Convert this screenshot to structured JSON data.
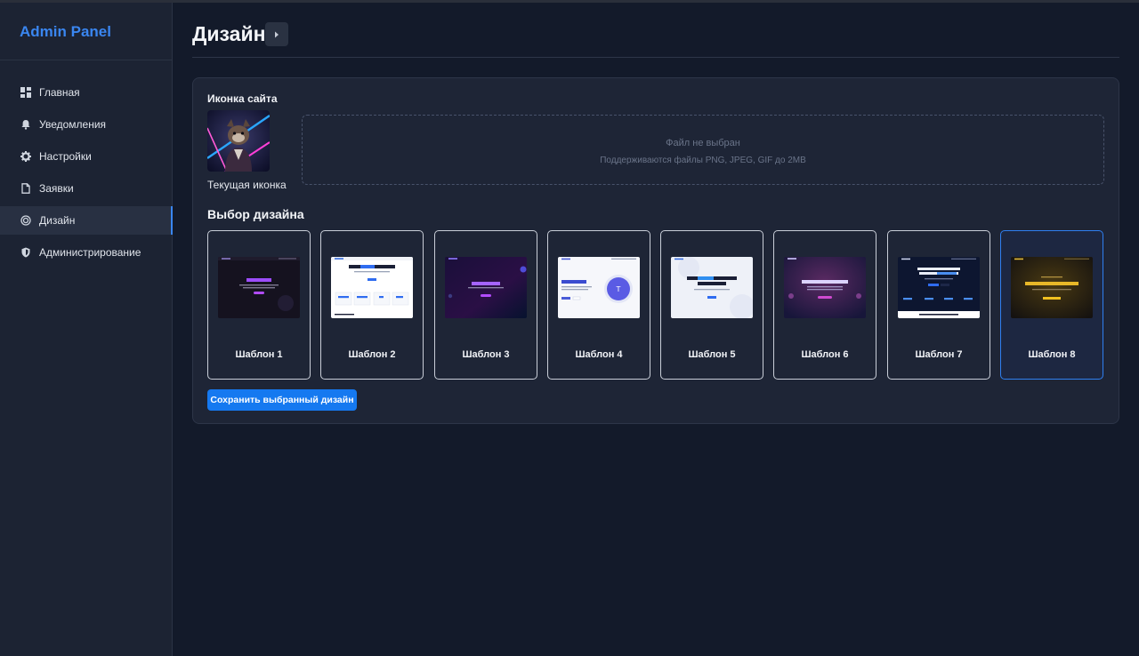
{
  "app": {
    "brand": "Admin Panel"
  },
  "sidebar": {
    "items": [
      {
        "label": "Главная",
        "icon": "dashboard-icon"
      },
      {
        "label": "Уведомления",
        "icon": "bell-icon"
      },
      {
        "label": "Настройки",
        "icon": "gear-icon"
      },
      {
        "label": "Заявки",
        "icon": "document-icon"
      },
      {
        "label": "Дизайн",
        "icon": "palette-icon",
        "active": true
      },
      {
        "label": "Администрирование",
        "icon": "shield-icon"
      }
    ]
  },
  "header": {
    "title": "Дизайн"
  },
  "favicon": {
    "section_label": "Иконка сайта",
    "current_caption": "Текущая иконка",
    "dropzone_main": "Файл не выбран",
    "dropzone_hint": "Поддерживаются файлы PNG, JPEG, GIF до 2MB"
  },
  "design": {
    "title": "Выбор дизайна",
    "templates": [
      {
        "label": "Шаблон 1"
      },
      {
        "label": "Шаблон 2"
      },
      {
        "label": "Шаблон 3"
      },
      {
        "label": "Шаблон 4"
      },
      {
        "label": "Шаблон 5"
      },
      {
        "label": "Шаблон 6"
      },
      {
        "label": "Шаблон 7"
      },
      {
        "label": "Шаблон 8",
        "selected": true
      }
    ],
    "save_label": "Сохранить выбранный дизайн"
  },
  "colors": {
    "accent": "#1579f0",
    "brand": "#3a86f0",
    "selected_border": "#2f7ff0"
  }
}
